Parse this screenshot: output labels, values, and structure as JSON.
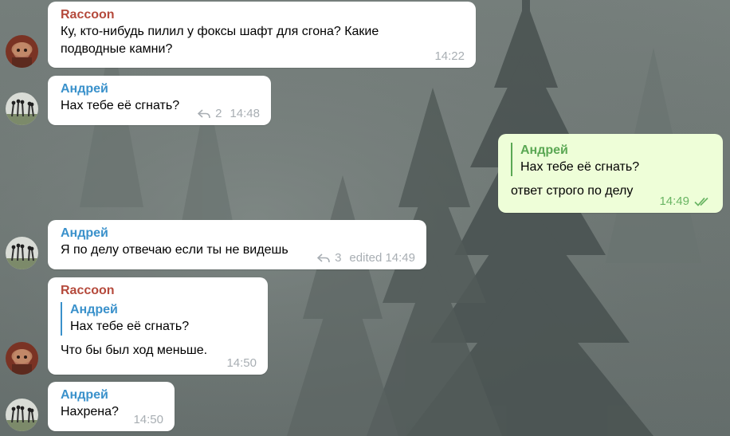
{
  "colors": {
    "raccoon_name": "#b54a3c",
    "andrey_name": "#3a91cb",
    "outgoing_name": "#5ba854",
    "outgoing_bubble": "#eefed8",
    "incoming_bubble": "#ffffff"
  },
  "messages": [
    {
      "sender": "Raccoon",
      "text": "Ку, кто-нибудь пилил у фоксы шафт для сгона? Какие подводные камни?",
      "time": "14:22"
    },
    {
      "sender": "Андрей",
      "text": "Нах тебе её сгнать?",
      "replies": "2",
      "time": "14:48"
    },
    {
      "quote_sender": "Андрей",
      "quote_text": "Нах тебе её сгнать?",
      "text": "ответ строго по делу",
      "time": "14:49",
      "status_icon": "double-check-icon"
    },
    {
      "sender": "Андрей",
      "text": "Я по делу отвечаю если ты не видешь",
      "replies": "3",
      "time": "edited 14:49"
    },
    {
      "sender": "Raccoon",
      "quote_sender": "Андрей",
      "quote_text": "Нах тебе её сгнать?",
      "text": "Что бы был ход меньше.",
      "time": "14:50"
    },
    {
      "sender": "Андрей",
      "text": "Нахрена?",
      "time": "14:50"
    }
  ]
}
